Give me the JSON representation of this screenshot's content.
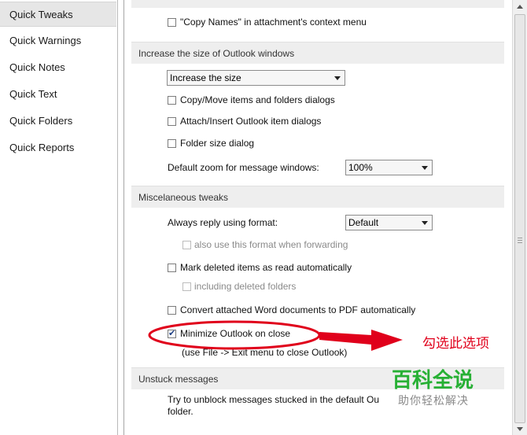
{
  "sidebar": {
    "items": [
      {
        "label": "Quick Tweaks"
      },
      {
        "label": "Quick Warnings"
      },
      {
        "label": "Quick Notes"
      },
      {
        "label": "Quick Text"
      },
      {
        "label": "Quick Folders"
      },
      {
        "label": "Quick Reports"
      }
    ]
  },
  "options": {
    "copy_names": "\"Copy Names\" in attachment's context menu",
    "section_increase": "Increase the size of Outlook windows",
    "increase_select": "Increase the size",
    "copy_move": "Copy/Move items and folders dialogs",
    "attach_insert": "Attach/Insert Outlook item dialogs",
    "folder_size": "Folder size dialog",
    "zoom_label": "Default zoom for message windows:",
    "zoom_value": "100%",
    "section_misc": "Miscelaneous tweaks",
    "reply_label": "Always reply using format:",
    "reply_value": "Default",
    "also_use": "also use this format when forwarding",
    "mark_deleted": "Mark deleted items as read automatically",
    "including_deleted": "including deleted folders",
    "convert_word": "Convert attached Word documents to PDF automatically",
    "minimize_outlook": "Minimize Outlook on close",
    "minimize_hint": "(use File -> Exit menu to close Outlook)",
    "section_unstuck": "Unstuck messages",
    "unstuck_text_1": "Try to unblock messages stucked in the default Ou",
    "unstuck_text_2": "folder."
  },
  "annotation": {
    "callout_text": "勾选此选项",
    "watermark_main": "百科全说",
    "watermark_sub": "助你轻松解决",
    "callout_color": "#e0001b",
    "watermark_color": "#27b034"
  }
}
